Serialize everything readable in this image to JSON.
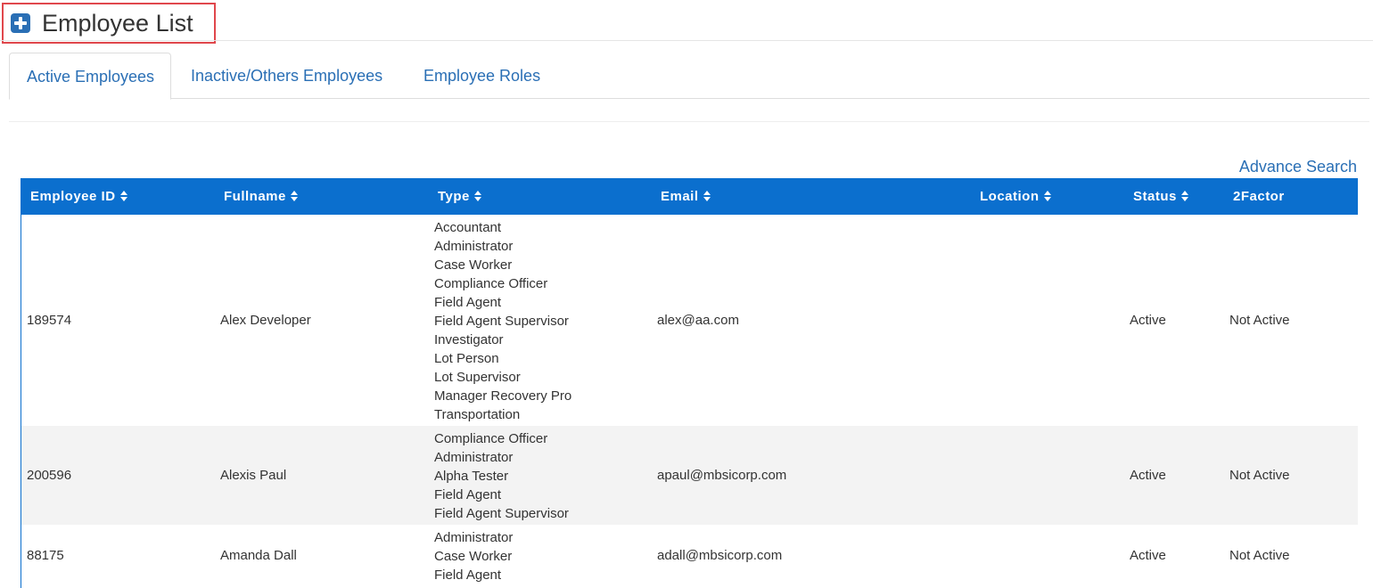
{
  "header": {
    "title": "Employee List",
    "icon": "plus-square-icon"
  },
  "tabs": [
    {
      "label": "Active Employees",
      "active": true
    },
    {
      "label": "Inactive/Others Employees",
      "active": false
    },
    {
      "label": "Employee Roles",
      "active": false
    }
  ],
  "advance_search_label": "Advance Search",
  "colors": {
    "accent": "#2a6fb5",
    "table_header": "#0b6fce",
    "highlight_border": "#e0474c",
    "row_alt": "#f3f3f3"
  },
  "table": {
    "columns": [
      "Employee ID",
      "Fullname",
      "Type",
      "Email",
      "Location",
      "Status",
      "2Factor"
    ],
    "sortable": [
      true,
      true,
      true,
      true,
      true,
      true,
      false
    ],
    "rows": [
      {
        "id": "189574",
        "fullname": "Alex Developer",
        "types": [
          "Accountant",
          "Administrator",
          "Case Worker",
          "Compliance Officer",
          "Field Agent",
          "Field Agent Supervisor",
          "Investigator",
          "Lot Person",
          "Lot Supervisor",
          "Manager Recovery Pro",
          "Transportation"
        ],
        "email": "alex@aa.com",
        "location": "",
        "status": "Active",
        "twofactor": "Not Active"
      },
      {
        "id": "200596",
        "fullname": "Alexis Paul",
        "types": [
          "Compliance Officer",
          "Administrator",
          "Alpha Tester",
          "Field Agent",
          "Field Agent Supervisor"
        ],
        "email": "apaul@mbsicorp.com",
        "location": "",
        "status": "Active",
        "twofactor": "Not Active"
      },
      {
        "id": "88175",
        "fullname": "Amanda Dall",
        "types": [
          "Administrator",
          "Case Worker",
          "Field Agent"
        ],
        "email": "adall@mbsicorp.com",
        "location": "",
        "status": "Active",
        "twofactor": "Not Active"
      }
    ]
  }
}
